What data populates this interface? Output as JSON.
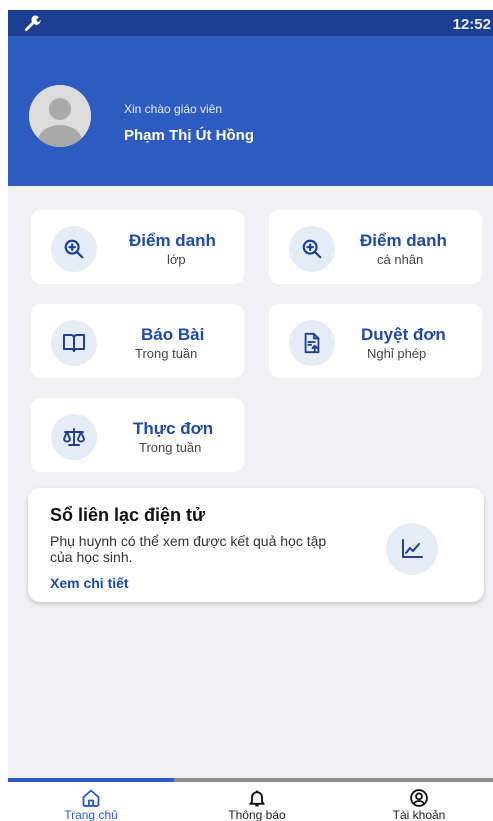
{
  "status_bar": {
    "time": "12:52"
  },
  "header": {
    "greeting": "Xin chào giáo viên",
    "teacher_name": "Phạm Thị Út Hồng"
  },
  "menu": {
    "attendance_class": {
      "title": "Điểm danh",
      "subtitle": "lớp",
      "icon": "zoom-plus-icon"
    },
    "attendance_personal": {
      "title": "Điểm danh",
      "subtitle": "cá nhân",
      "icon": "zoom-plus-icon"
    },
    "lesson_report": {
      "title": "Báo Bài",
      "subtitle": "Trong tuần",
      "icon": "book-icon"
    },
    "leave_approval": {
      "title": "Duyệt đơn",
      "subtitle": "Nghỉ phép",
      "icon": "document-upload-icon"
    },
    "menu_weekly": {
      "title": "Thực đơn",
      "subtitle": "Trong tuần",
      "icon": "scale-icon"
    }
  },
  "contact_book": {
    "title": "Sổ liên lạc điện tử",
    "description": "Phụ huynh có thể xem được kết quả học tập của học sinh.",
    "link": "Xem chi tiết",
    "icon": "line-chart-icon"
  },
  "tabbar": {
    "tabs": [
      {
        "label": "Trang chủ",
        "icon": "home-icon",
        "active": true
      },
      {
        "label": "Thông báo",
        "icon": "bell-icon",
        "active": false
      },
      {
        "label": "Tài khoản",
        "icon": "account-icon",
        "active": false
      }
    ]
  },
  "colors": {
    "header_blue": "#2e5bbf",
    "status_bar_blue": "#1b3e91",
    "accent_text": "#1f4aa6",
    "icon_circle": "#e6ecf6",
    "background": "#f1f1f4"
  }
}
